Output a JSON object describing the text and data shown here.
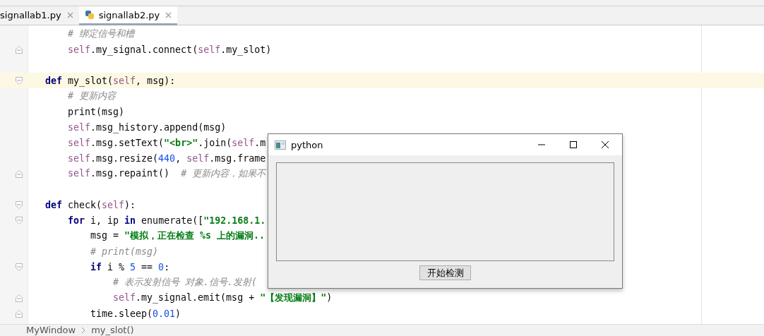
{
  "tabs": [
    {
      "label": "signallab1.py",
      "selected": false
    },
    {
      "label": "signallab2.py",
      "selected": true
    }
  ],
  "editor": {
    "lines": [
      {
        "kind": "group",
        "children": [
          {
            "kind": "code",
            "current": false,
            "fold_start": false,
            "fold_end": false,
            "tokens": [
              {
                "kind": "comment",
                "text": "# 绑定信号和槽"
              }
            ]
          },
          {
            "kind": "code",
            "current": false,
            "fold_start": false,
            "fold_end": true,
            "tokens": [
              {
                "kind": "self",
                "text": "self"
              },
              {
                "kind": "plain",
                "text": ".my_signal.connect("
              },
              {
                "kind": "self",
                "text": "self"
              },
              {
                "kind": "plain",
                "text": ".my_slot)"
              }
            ]
          }
        ]
      },
      {
        "kind": "blank"
      },
      {
        "kind": "code",
        "current": true,
        "fold_start": true,
        "fold_end": false,
        "tokens": [
          {
            "kind": "kw",
            "text": "def "
          },
          {
            "kind": "plain",
            "text": "my_slot("
          },
          {
            "kind": "self",
            "text": "self"
          },
          {
            "kind": "plain",
            "text": ", msg):"
          }
        ],
        "children": [
          {
            "kind": "code",
            "current": false,
            "fold_start": false,
            "fold_end": false,
            "tokens": [
              {
                "kind": "comment",
                "text": "# 更新内容"
              }
            ]
          },
          {
            "kind": "code",
            "current": false,
            "fold_start": false,
            "fold_end": false,
            "tokens": [
              {
                "kind": "plain",
                "text": "print(msg)"
              }
            ]
          },
          {
            "kind": "code",
            "current": false,
            "fold_start": false,
            "fold_end": false,
            "tokens": [
              {
                "kind": "self",
                "text": "self"
              },
              {
                "kind": "plain",
                "text": ".msg_history.append(msg)"
              }
            ]
          },
          {
            "kind": "code",
            "current": false,
            "fold_start": false,
            "fold_end": false,
            "tokens": [
              {
                "kind": "self",
                "text": "self"
              },
              {
                "kind": "plain",
                "text": ".msg.setText("
              },
              {
                "kind": "str",
                "text": "\"<br>\""
              },
              {
                "kind": "plain",
                "text": ".join("
              },
              {
                "kind": "self",
                "text": "self"
              },
              {
                "kind": "plain",
                "text": ".m"
              }
            ]
          },
          {
            "kind": "code",
            "current": false,
            "fold_start": false,
            "fold_end": false,
            "tokens": [
              {
                "kind": "self",
                "text": "self"
              },
              {
                "kind": "plain",
                "text": ".msg.resize("
              },
              {
                "kind": "num",
                "text": "440"
              },
              {
                "kind": "plain",
                "text": ", "
              },
              {
                "kind": "self",
                "text": "self"
              },
              {
                "kind": "plain",
                "text": ".msg.frame"
              }
            ]
          },
          {
            "kind": "code",
            "current": false,
            "fold_start": false,
            "fold_end": true,
            "tokens": [
              {
                "kind": "self",
                "text": "self"
              },
              {
                "kind": "plain",
                "text": ".msg.repaint()  "
              },
              {
                "kind": "comment",
                "text": "# 更新内容，如果不"
              }
            ]
          }
        ]
      },
      {
        "kind": "blank"
      },
      {
        "kind": "code",
        "current": false,
        "fold_start": true,
        "fold_end": false,
        "tokens": [
          {
            "kind": "kw",
            "text": "def "
          },
          {
            "kind": "plain",
            "text": "check("
          },
          {
            "kind": "self",
            "text": "self"
          },
          {
            "kind": "plain",
            "text": "):"
          }
        ],
        "children": [
          {
            "kind": "code",
            "current": false,
            "fold_start": true,
            "fold_end": false,
            "tokens": [
              {
                "kind": "kw",
                "text": "for "
              },
              {
                "kind": "plain",
                "text": "i, ip "
              },
              {
                "kind": "kw",
                "text": "in "
              },
              {
                "kind": "plain",
                "text": "enumerate(["
              },
              {
                "kind": "str",
                "text": "\"192.168.1."
              }
            ],
            "children": [
              {
                "kind": "code",
                "current": false,
                "fold_start": false,
                "fold_end": false,
                "tokens": [
                  {
                    "kind": "plain",
                    "text": "msg = "
                  },
                  {
                    "kind": "str",
                    "text": "\"模拟，正在检查 %s 上的漏洞.."
                  }
                ]
              },
              {
                "kind": "code",
                "current": false,
                "fold_start": false,
                "fold_end": false,
                "tokens": [
                  {
                    "kind": "comment",
                    "text": "# print(msg)"
                  }
                ]
              },
              {
                "kind": "code",
                "current": false,
                "fold_start": true,
                "fold_end": false,
                "tokens": [
                  {
                    "kind": "kw",
                    "text": "if "
                  },
                  {
                    "kind": "plain",
                    "text": "i % "
                  },
                  {
                    "kind": "num",
                    "text": "5"
                  },
                  {
                    "kind": "plain",
                    "text": " == "
                  },
                  {
                    "kind": "num",
                    "text": "0"
                  },
                  {
                    "kind": "plain",
                    "text": ":"
                  }
                ],
                "children": [
                  {
                    "kind": "code",
                    "current": false,
                    "fold_start": false,
                    "fold_end": false,
                    "tokens": [
                      {
                        "kind": "comment",
                        "text": "# 表示发射信号 对象.信号.发射("
                      }
                    ]
                  },
                  {
                    "kind": "code",
                    "current": false,
                    "fold_start": false,
                    "fold_end": true,
                    "tokens": [
                      {
                        "kind": "self",
                        "text": "self"
                      },
                      {
                        "kind": "plain",
                        "text": ".my_signal.emit(msg + "
                      },
                      {
                        "kind": "str",
                        "text": "\"【发现漏洞】\""
                      },
                      {
                        "kind": "plain",
                        "text": ")"
                      }
                    ]
                  }
                ]
              },
              {
                "kind": "code",
                "current": false,
                "fold_start": false,
                "fold_end": true,
                "tokens": [
                  {
                    "kind": "plain",
                    "text": "time.sleep("
                  },
                  {
                    "kind": "num",
                    "text": "0.01"
                  },
                  {
                    "kind": "plain",
                    "text": ")"
                  }
                ]
              }
            ]
          }
        ]
      }
    ]
  },
  "breadcrumb": [
    "MyWindow",
    "my_slot()"
  ],
  "dialog": {
    "title": "python",
    "button": "开始检测"
  }
}
